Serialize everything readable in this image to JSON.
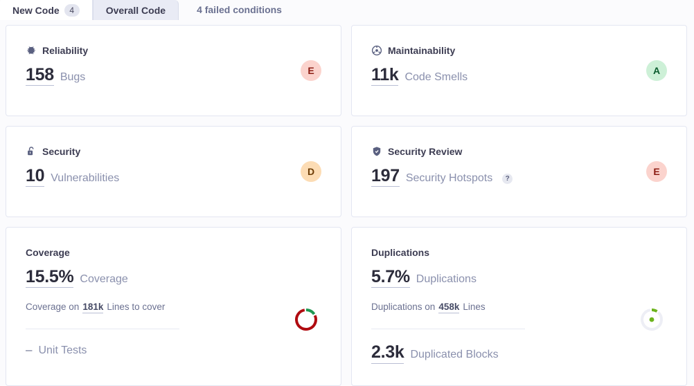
{
  "tabs": [
    {
      "label": "New Code",
      "badge": "4",
      "selected": false,
      "name": "tab-new-code"
    },
    {
      "label": "Overall Code",
      "badge": null,
      "selected": true,
      "name": "tab-overall-code"
    }
  ],
  "failed_conditions": "4 failed conditions",
  "cards": {
    "reliability": {
      "icon": "bug-icon",
      "title": "Reliability",
      "value": "158",
      "label": "Bugs",
      "rating": "E",
      "rating_bg": "#fbd3cd",
      "rating_fg": "#8b1c12"
    },
    "maintainability": {
      "icon": "code-smell-icon",
      "title": "Maintainability",
      "value": "11k",
      "label": "Code Smells",
      "rating": "A",
      "rating_bg": "#cdf0d7",
      "rating_fg": "#0b5c2e"
    },
    "security": {
      "icon": "open-lock-icon",
      "title": "Security",
      "value": "10",
      "label": "Vulnerabilities",
      "rating": "D",
      "rating_bg": "#fcdcb4",
      "rating_fg": "#6c3b04"
    },
    "security_review": {
      "icon": "shield-icon",
      "title": "Security Review",
      "value": "197",
      "label": "Security Hotspots",
      "help": "?",
      "rating": "E",
      "rating_bg": "#fbd3cd",
      "rating_fg": "#8b1c12"
    },
    "coverage": {
      "title": "Coverage",
      "value": "15.5%",
      "label": "Coverage",
      "sub_prefix": "Coverage on",
      "sub_value": "181k",
      "sub_suffix": "Lines to cover",
      "footer_value": "–",
      "footer_label": "Unit Tests",
      "donut_percent": 15.5,
      "donut_fill_color": "#1f9752",
      "donut_track_color": "#b00b10"
    },
    "duplications": {
      "title": "Duplications",
      "value": "5.7%",
      "label": "Duplications",
      "sub_prefix": "Duplications on",
      "sub_value": "458k",
      "sub_suffix": "Lines",
      "footer_value": "2.3k",
      "footer_label": "Duplicated Blocks",
      "donut_percent": 9,
      "donut_fill_color": "#6cb31d",
      "donut_track_color": "#edeef5",
      "donut_center_color": "#6cb31d"
    }
  }
}
